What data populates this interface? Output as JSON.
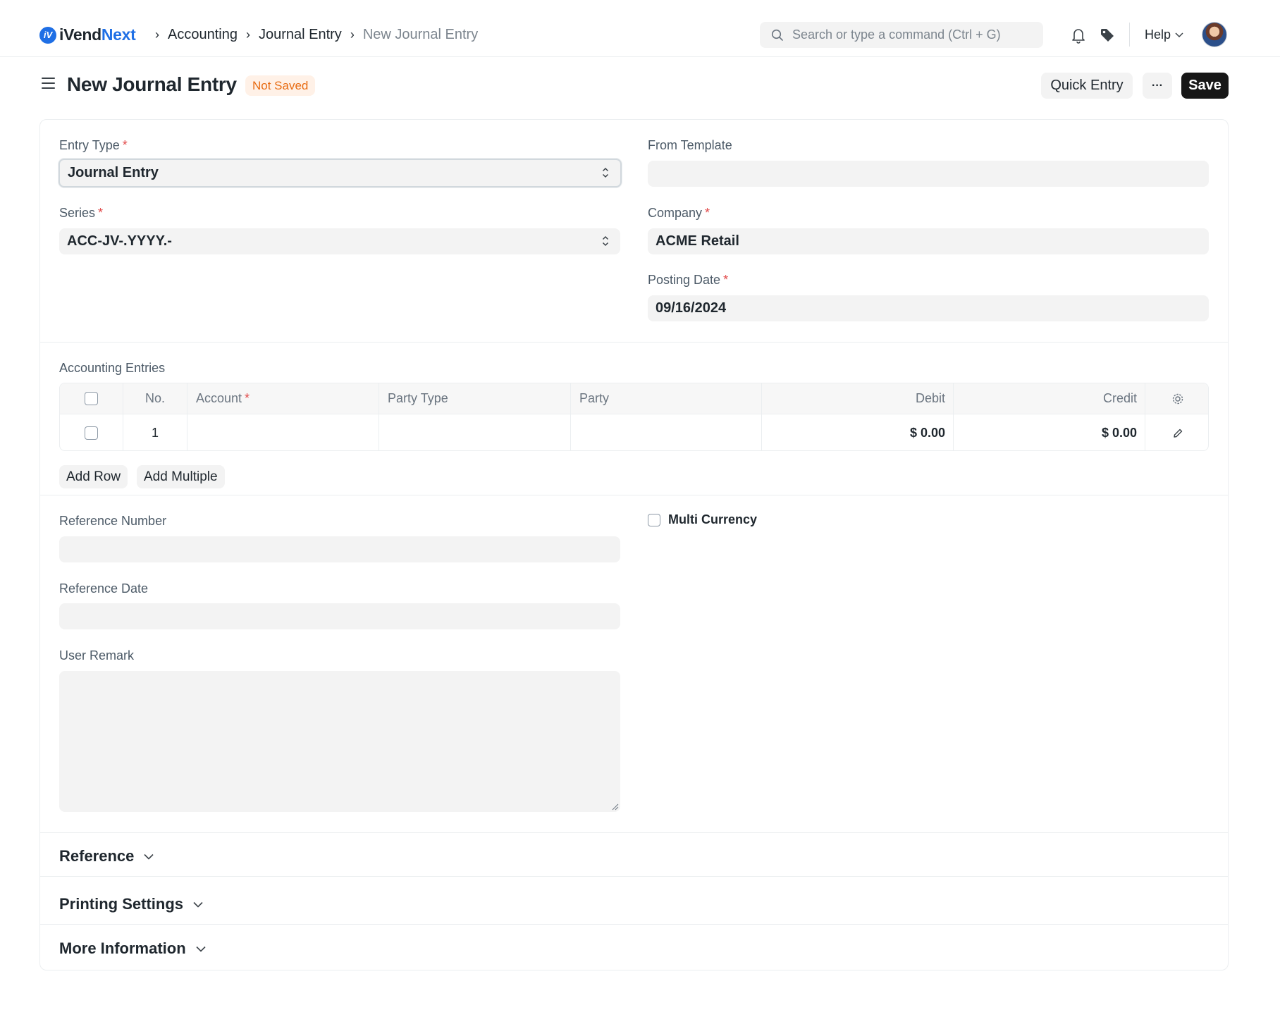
{
  "brand": {
    "name_part1": "iVend",
    "name_part2": "Next"
  },
  "breadcrumbs": [
    "Accounting",
    "Journal Entry",
    "New Journal Entry"
  ],
  "search": {
    "placeholder": "Search or type a command (Ctrl + G)"
  },
  "navbar": {
    "help_label": "Help"
  },
  "page": {
    "title": "New Journal Entry",
    "status": "Not Saved",
    "quick_entry_label": "Quick Entry",
    "more_label": "···",
    "save_label": "Save"
  },
  "form": {
    "entry_type": {
      "label": "Entry Type",
      "value": "Journal Entry"
    },
    "from_template": {
      "label": "From Template",
      "value": ""
    },
    "series": {
      "label": "Series",
      "value": "ACC-JV-.YYYY.-"
    },
    "company": {
      "label": "Company",
      "value": "ACME Retail"
    },
    "posting_date": {
      "label": "Posting Date",
      "value": "09/16/2024"
    },
    "accounting_entries": {
      "label": "Accounting Entries",
      "columns": [
        "No.",
        "Account",
        "Party Type",
        "Party",
        "Debit",
        "Credit"
      ],
      "rows": [
        {
          "no": "1",
          "account": "",
          "party_type": "",
          "party": "",
          "debit": "$ 0.00",
          "credit": "$ 0.00"
        }
      ],
      "add_row_label": "Add Row",
      "add_multiple_label": "Add Multiple"
    },
    "reference_number": {
      "label": "Reference Number",
      "value": ""
    },
    "multi_currency": {
      "label": "Multi Currency",
      "checked": false
    },
    "reference_date": {
      "label": "Reference Date",
      "value": ""
    },
    "user_remark": {
      "label": "User Remark",
      "value": ""
    }
  },
  "sections": [
    "Reference",
    "Printing Settings",
    "More Information"
  ],
  "colors": {
    "accent": "#1f6fe5",
    "badge_bg": "#fff1e7",
    "badge_text": "#e86c13",
    "primary_button": "#171717",
    "required": "#e24c4c"
  },
  "icons": [
    "search-icon",
    "bell-icon",
    "tag-icon",
    "chevron-down-icon",
    "settings-icon",
    "edit-icon",
    "menu-icon"
  ]
}
